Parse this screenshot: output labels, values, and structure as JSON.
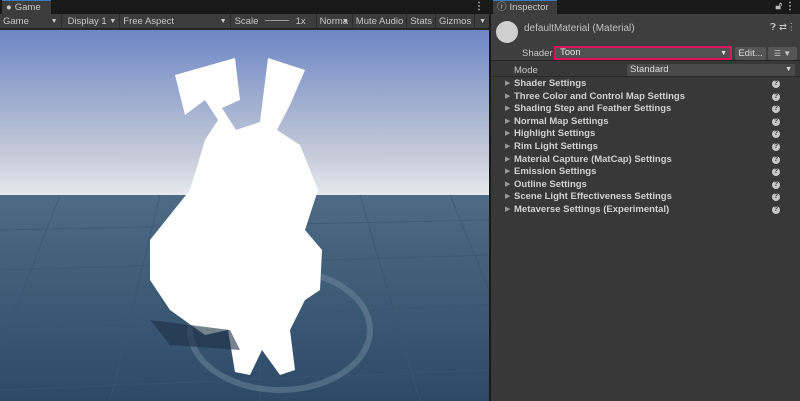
{
  "game": {
    "tab": "Game",
    "toolbar": {
      "view": "Game",
      "display": "Display 1",
      "aspect": "Free Aspect",
      "scale_label": "Scale",
      "scale_value": "1x",
      "normal": "Norma",
      "mute": "Mute Audio",
      "stats": "Stats",
      "gizmos": "Gizmos"
    }
  },
  "inspector": {
    "tab": "Inspector",
    "material": "defaultMaterial (Material)",
    "shader_label": "Shader",
    "shader": "Toon",
    "edit": "Edit...",
    "mode_label": "Mode",
    "mode": "Standard",
    "sections": [
      "Shader Settings",
      "Three Color and Control Map Settings",
      "Shading Step and Feather Settings",
      "Normal Map Settings",
      "Highlight Settings",
      "Rim Light Settings",
      "Material Capture (MatCap) Settings",
      "Emission Settings",
      "Outline Settings",
      "Scene Light Effectiveness Settings",
      "Metaverse Settings (Experimental)"
    ]
  },
  "colors": {
    "highlight": "#e0115f",
    "accent": "#3a79bb"
  }
}
